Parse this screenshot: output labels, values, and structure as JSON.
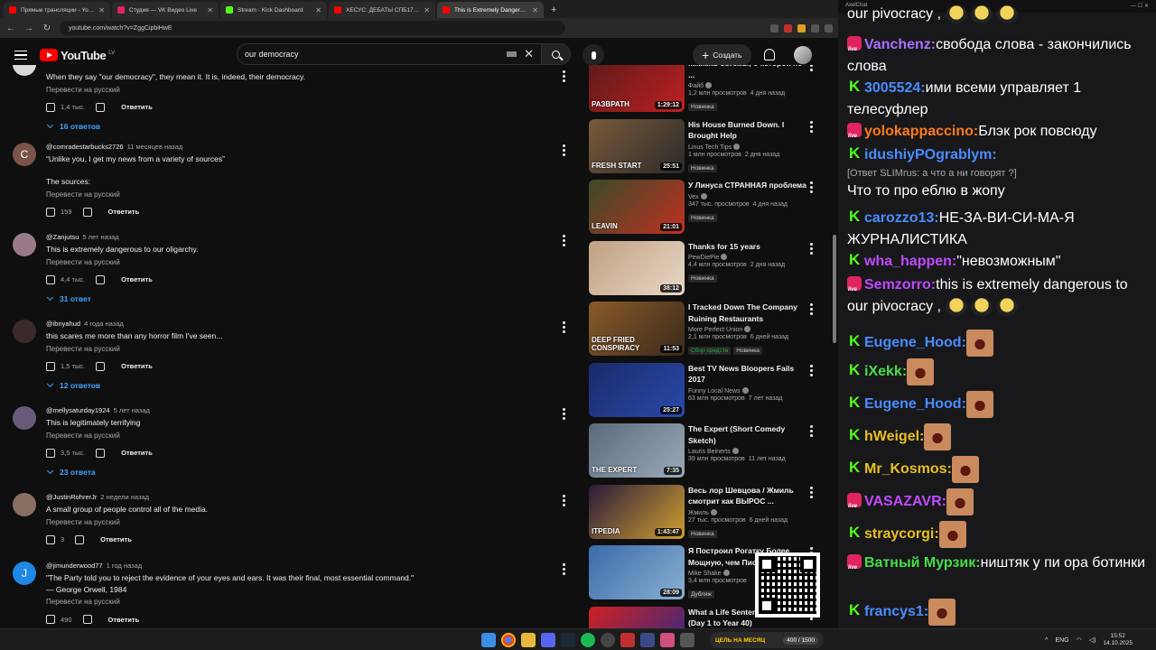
{
  "browser": {
    "tabs": [
      {
        "label": "Прямые трансляции - YouTube",
        "color": "#ff0000"
      },
      {
        "label": "Студия — VK Видео Live",
        "color": "#e0245e"
      },
      {
        "label": "Stream - Kick Dashboard",
        "color": "#53fc18"
      },
      {
        "label": "ХЕСУС: ДЕБАТЫ СПБ1703 И МАКОМ",
        "color": "#ff0000"
      },
      {
        "label": "This is Extremely Dangerous to...",
        "color": "#ff0000",
        "active": true
      }
    ],
    "new_tab": "+",
    "url": "youtube.com/watch?v=ZggCipbiHwE"
  },
  "stream_stats": [
    {
      "value": "131",
      "color": "#ff0000"
    },
    {
      "value": "1,206",
      "color": "#53fc18"
    },
    {
      "value": "575",
      "color": "#e0245e"
    },
    {
      "value": "1,912",
      "color": "#1a73e8"
    }
  ],
  "youtube": {
    "logo": "YouTube",
    "logo_country": "LV",
    "search_query": "our democracy",
    "create_label": "Создать"
  },
  "comments": [
    {
      "author": "",
      "date": "",
      "text": "When they say \"our democracy\", they mean it. It is, indeed, their democracy.",
      "translate": "Перевести на русский",
      "likes": "1,4 тыс.",
      "reply": "Ответить",
      "replies": "16 ответов",
      "avatar_letter": "",
      "avatar_color": "#d9d9d9"
    },
    {
      "author": "@comradestarbucks2726",
      "date": "11 месяцев назад",
      "text": "“Unlike you, I get my news from a variety of sources”\n\nThe sources:",
      "translate": "Перевести на русский",
      "likes": "159",
      "reply": "Ответить",
      "replies": "",
      "avatar_letter": "C",
      "avatar_color": "#795548"
    },
    {
      "author": "@Zanjutsu",
      "date": "5 лет назад",
      "text": "This is extremely dangerous to our oligarchy.",
      "translate": "Перевести на русский",
      "likes": "4,4 тыс.",
      "reply": "Ответить",
      "replies": "31 ответ",
      "avatar_letter": "",
      "avatar_color": "#9a7a8a"
    },
    {
      "author": "@ibnyahud",
      "date": "4 года назад",
      "text": "this scares me more than any horror film I've seen...",
      "translate": "Перевести на русский",
      "likes": "1,5 тыс.",
      "reply": "Ответить",
      "replies": "12 ответов",
      "avatar_letter": "",
      "avatar_color": "#3b2a2a"
    },
    {
      "author": "@mellysaturday1924",
      "date": "5 лет назад",
      "text": "This is legitimately terrifying",
      "translate": "Перевести на русский",
      "likes": "3,5 тыс.",
      "reply": "Ответить",
      "replies": "23 ответа",
      "avatar_letter": "",
      "avatar_color": "#6a5a7a"
    },
    {
      "author": "@JustinRohrerJr",
      "date": "2 недели назад",
      "text": "A small group of people control all of the media.",
      "translate": "Перевести на русский",
      "likes": "3",
      "reply": "Ответить",
      "replies": "",
      "avatar_letter": "",
      "avatar_color": "#8a7060"
    },
    {
      "author": "@jimunderwood77",
      "date": "1 год назад",
      "text": "\"The Party told you to reject the evidence of your eyes and ears. It was their final, most essential command.\"\n— George Orwell, 1984",
      "translate": "Перевести на русский",
      "likes": "490",
      "reply": "Ответить",
      "replies": "",
      "avatar_letter": "J",
      "avatar_color": "#1e88e5"
    }
  ],
  "recommended": [
    {
      "title": "...жизнь богемы, о которой не ...",
      "channel": "Файб",
      "views": "1,2 млн просмотров",
      "age": "4 дня назад",
      "badges": [
        "Новинка"
      ],
      "duration": "1:29:12",
      "overlay": "РАЗВРАТН",
      "color1": "#5a1a1a",
      "color2": "#c02020"
    },
    {
      "title": "His House Burned Down. I Brought Help",
      "channel": "Linus Tech Tips",
      "views": "1 млн просмотров",
      "age": "2 дня назад",
      "badges": [
        "Новинка"
      ],
      "duration": "25:51",
      "overlay": "FRESH START",
      "color1": "#7a5a3a",
      "color2": "#2a2a2a"
    },
    {
      "title": "У Линуса СТРАННАЯ проблема",
      "channel": "Vex",
      "views": "347 тыс. просмотров",
      "age": "4 дня назад",
      "badges": [
        "Новинка"
      ],
      "duration": "21:01",
      "overlay": "LEAVIN",
      "color1": "#3a4a2a",
      "color2": "#c03020"
    },
    {
      "title": "Thanks for 15 years",
      "channel": "PewDiePie",
      "views": "4,4 млн просмотров",
      "age": "2 дня назад",
      "badges": [
        "Новинка"
      ],
      "duration": "38:12",
      "overlay": "",
      "color1": "#c0a080",
      "color2": "#e8d8c8"
    },
    {
      "title": "I Tracked Down The Company Ruining Restaurants",
      "channel": "More Perfect Union",
      "views": "2,1 млн просмотров",
      "age": "6 дней назад",
      "badges": [
        "Сбор средств",
        "Новинка"
      ],
      "duration": "11:53",
      "overlay": "DEEP FRIED CONSPIRACY",
      "color1": "#8a5a2a",
      "color2": "#3a2a1a"
    },
    {
      "title": "Best TV News Bloopers Fails 2017",
      "channel": "Funny Local News",
      "views": "63 млн просмотров",
      "age": "7 лет назад",
      "badges": [],
      "duration": "25:27",
      "overlay": "",
      "color1": "#1a2a6a",
      "color2": "#2a4aaa"
    },
    {
      "title": "The Expert (Short Comedy Sketch)",
      "channel": "Lauris Beinerts",
      "views": "39 млн просмотров",
      "age": "11 лет назад",
      "badges": [],
      "duration": "7:35",
      "overlay": "THE EXPERT",
      "color1": "#5a6a7a",
      "color2": "#9aaaba"
    },
    {
      "title": "Весь лор Шевцова / Жмиль смотрит как ВЫРОС ...",
      "channel": "Жмиль",
      "views": "27 тыс. просмотров",
      "age": "6 дней назад",
      "badges": [
        "Новинка"
      ],
      "duration": "1:43:47",
      "overlay": "ITPEDIA",
      "color1": "#2a1a3a",
      "color2": "#d0a030"
    },
    {
      "title": "Я Построил Рогатку Более Мощную, чем Пист...",
      "channel": "Mike Shake",
      "views": "3,4 млн просмотров",
      "age": "",
      "badges": [
        "Дубляж"
      ],
      "duration": "28:09",
      "overlay": "",
      "color1": "#3a6aaa",
      "color2": "#8ab0d0"
    },
    {
      "title": "What a Life Sentence Feels Like (Day 1 to Year 40)",
      "channel": "",
      "views": "",
      "age": "",
      "badges": [],
      "duration": "",
      "overlay": "NO ESCAPE",
      "color1": "#d02020",
      "color2": "#2a2a8a"
    }
  ],
  "chat": {
    "window_title": "AxelChat",
    "messages": [
      {
        "platform": "",
        "nick": "",
        "nick_color": "#ffffff",
        "quote": "",
        "text": "our pivocracy ,",
        "emotes": [
          "dance",
          "dance",
          "dance"
        ]
      },
      {
        "platform": "live",
        "nick": "Vanchenz:",
        "nick_color": "#a970ff",
        "quote": "",
        "text": "свобода слова - закончились слова",
        "emotes": []
      },
      {
        "platform": "kick",
        "nick": "3005524:",
        "nick_color": "#4a8cff",
        "quote": "",
        "text": "ими всеми управляет 1 телесуфлер",
        "emotes": []
      },
      {
        "platform": "live",
        "nick": "yolokappaccino:",
        "nick_color": "#ff7a1a",
        "quote": "",
        "text": "Блэк рок повсюду",
        "emotes": []
      },
      {
        "platform": "kick",
        "nick": "idushiyPOgrablym:",
        "nick_color": "#4a8cff",
        "quote": "[Ответ SLIMrus: а что а ни говорят ?]",
        "text": "Что то про еблю в жопу",
        "emotes": []
      },
      {
        "platform": "kick",
        "nick": "carozzo13:",
        "nick_color": "#4a8cff",
        "quote": "",
        "text": "НЕ-ЗА-ВИ-СИ-МА-Я ЖУРНАЛИСТИКА",
        "emotes": []
      },
      {
        "platform": "kick",
        "nick": "wha_happen:",
        "nick_color": "#c04aff",
        "quote": "",
        "text": "\"невозможным\"",
        "emotes": []
      },
      {
        "platform": "live",
        "nick": "Semzorro:",
        "nick_color": "#c04aff",
        "quote": "",
        "text": "this is extremely dangerous to our pivocracy ,",
        "emotes": [
          "dance",
          "dance",
          "dance"
        ]
      },
      {
        "platform": "kick",
        "nick": "Eugene_Hood:",
        "nick_color": "#4a8cff",
        "quote": "",
        "text": "",
        "emotes": [
          "face"
        ]
      },
      {
        "platform": "kick",
        "nick": "iXekk:",
        "nick_color": "#4adc4a",
        "quote": "",
        "text": "",
        "emotes": [
          "face"
        ]
      },
      {
        "platform": "kick",
        "nick": "Eugene_Hood:",
        "nick_color": "#4a8cff",
        "quote": "",
        "text": "",
        "emotes": [
          "face"
        ]
      },
      {
        "platform": "kick",
        "nick": "hWeigel:",
        "nick_color": "#e8c020",
        "quote": "",
        "text": "",
        "emotes": [
          "face"
        ]
      },
      {
        "platform": "kick",
        "nick": "Mr_Kosmos:",
        "nick_color": "#e8c020",
        "quote": "",
        "text": "",
        "emotes": [
          "face"
        ]
      },
      {
        "platform": "live",
        "nick": "VASAZAVR:",
        "nick_color": "#c04aff",
        "quote": "",
        "text": "",
        "emotes": [
          "face"
        ]
      },
      {
        "platform": "kick",
        "nick": "straycorgi:",
        "nick_color": "#e8c020",
        "quote": "",
        "text": "",
        "emotes": [
          "face"
        ]
      },
      {
        "platform": "live",
        "nick": "Ватный Мурзик:",
        "nick_color": "#4adc4a",
        "quote": "",
        "text": "ништяк у пи ора ботинки",
        "emotes": []
      },
      {
        "platform": "kick",
        "nick": "francys1:",
        "nick_color": "#4a8cff",
        "quote": "",
        "text": "",
        "emotes": [
          "face"
        ]
      }
    ]
  },
  "taskbar": {
    "donate_label": "ЦЕЛЬ НА МЕСЯЦ",
    "donate_progress": "400 / 1500",
    "lang": "ENG",
    "time": "15:52",
    "date": "14.10.2025"
  }
}
